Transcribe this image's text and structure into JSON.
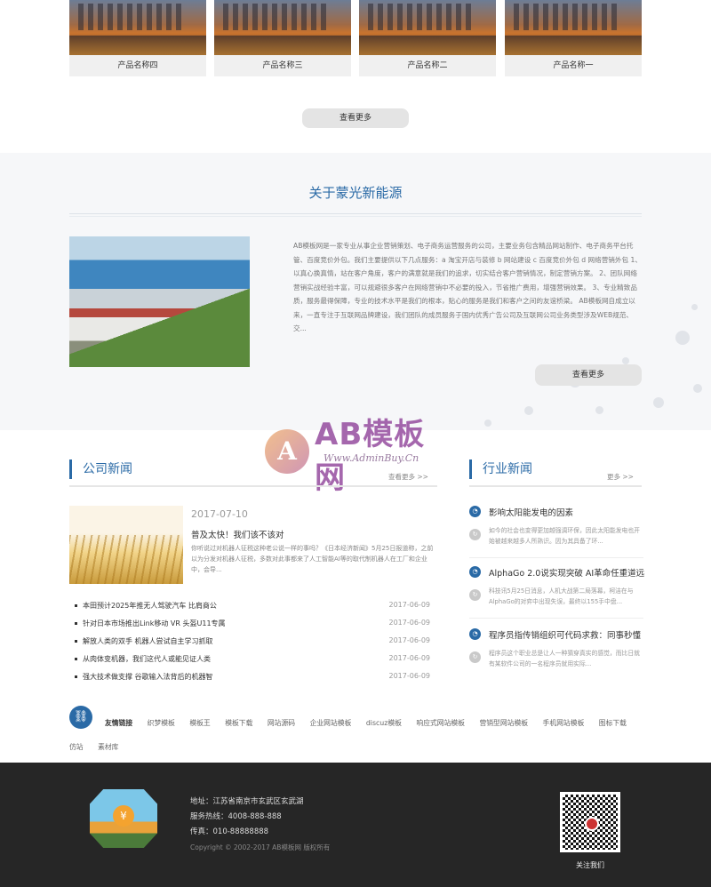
{
  "products": {
    "items": [
      {
        "name": "产品名称四"
      },
      {
        "name": "产品名称三"
      },
      {
        "name": "产品名称二"
      },
      {
        "name": "产品名称一"
      }
    ],
    "more_label": "查看更多"
  },
  "about": {
    "title": "关于蒙光新能源",
    "text": "AB模板网是一家专业从事企业营销策划、电子商务运营服务的公司，主要业务包含精品网站制作、电子商务平台托管、百度竞价外包。我们主要提供以下几点服务：a 淘宝开店与装修 b 网站建设 c 百度竞价外包 d 网络营销外包 1、以真心换真情，站在客户角度，客户的满意就是我们的追求，切实结合客户营销情况，制定营销方案。 2、团队网络营销实战经验丰富，可以规避很多客户在网络营销中不必要的投入，节省推广费用，增强营销效果。 3、专业精致品质，服务最得保障，专业的技术水平是我们的根本，贴心的服务是我们和客户之间的友谊桥梁。 AB模板网自成立以来，一直专注于互联网品牌建设，我们团队的成员服务于国内优秀广告公司及互联网公司业务类型涉及WEB规范、交...",
    "more_label": "查看更多"
  },
  "watermark": {
    "logo_letter": "A",
    "big": "AB模板网",
    "small": "Www.AdminBuy.Cn"
  },
  "company_news": {
    "title": "公司新闻",
    "more": "查看更多 >>",
    "featured": {
      "date": "2017-07-10",
      "headline": "普及太快！我们该不该对",
      "summary": "你听说过对机器人征税这种老公说一样的事吗？《日本经济新闻》5月25日报道称，之前以为分发对机器人征税，多数对此事都来了人工智能AI等的取代制机器人在工厂和企业中，会导..."
    },
    "list": [
      {
        "title": "本田预计2025年推无人驾驶汽车 比肩商公",
        "date": "2017-06-09"
      },
      {
        "title": "针对日本市场推出Link移动 VR 头盔U11专属",
        "date": "2017-06-09"
      },
      {
        "title": "解放人类的双手 机器人尝试自主学习抓取",
        "date": "2017-06-09"
      },
      {
        "title": "从肉体变机器，我们这代人或能见证人类",
        "date": "2017-06-09"
      },
      {
        "title": "强大技术做支撑 谷歌输入法背后的机器智",
        "date": "2017-06-09"
      }
    ]
  },
  "industry_news": {
    "title": "行业新闻",
    "more": "更多 >>",
    "items": [
      {
        "title": "影响太阳能发电的因素",
        "summary": "如今的社会也变得更加越强调环保，因此太阳能发电也开始被越来越多人所熟识。因为其具备了环..."
      },
      {
        "title": "AlphaGo 2.0说实现突破 AI革命任重道远",
        "summary": "科技讯5月25日消息，人机大战第二局落幕，柯洁在与AlphaGo的对弈中出现失误，最终以155手中盘..."
      },
      {
        "title": "程序员指传销组织可代码求救：同事秒懂",
        "summary": "程序员这个职业总是让人一种猜穿真实的感觉，而比日就有某软件公司的一名程序员就用实际..."
      }
    ],
    "icon_glyph": "◔",
    "icon2_glyph": "↻"
  },
  "links": {
    "icon_glyph": "⛓",
    "label": "友情链接",
    "items": [
      "织梦模板",
      "模板王",
      "模板下载",
      "网站源码",
      "企业网站模板",
      "discuz模板",
      "响应式网站模板",
      "营销型网站模板",
      "手机网站模板",
      "图标下载",
      "仿站",
      "素材库"
    ]
  },
  "footer": {
    "logo_glyph": "¥",
    "address": "地址：江苏省南京市玄武区玄武湖",
    "hotline": "服务热线：4008-888-888",
    "fax": "传真：010-88888888",
    "copyright": "Copyright © 2002-2017 AB模板网 版权所有",
    "qr_caption": "关注我们"
  }
}
